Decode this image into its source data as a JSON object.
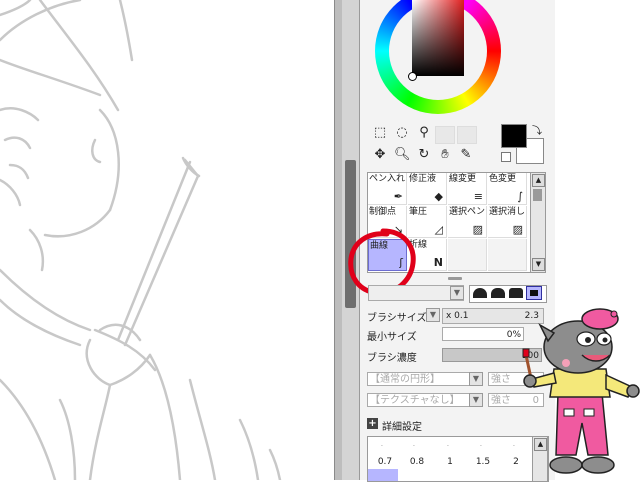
{
  "brush_modes": {
    "row1": [
      "ペン入れ",
      "修正液",
      "線変更",
      "色変更"
    ],
    "row2": [
      "制御点",
      "筆圧",
      "選択ペン",
      "選択消し"
    ],
    "row3": [
      "曲線",
      "折線"
    ]
  },
  "brush_size": {
    "label": "ブラシサイズ",
    "multiplier": "x 0.1",
    "value": "2.3"
  },
  "min_size": {
    "label": "最小サイズ",
    "value": "0%"
  },
  "brush_density": {
    "label": "ブラシ濃度",
    "value": "100"
  },
  "shape_select": {
    "value": "【通常の円形】",
    "strength": "強さ"
  },
  "texture_select": {
    "value": "【テクスチャなし】",
    "strength": "強さ",
    "strength_value": "0"
  },
  "detail_settings": {
    "label": "詳細設定",
    "icon": "plus-icon"
  },
  "size_presets": [
    "0.7",
    "0.8",
    "1",
    "1.5",
    "2"
  ],
  "tools": {
    "row1": [
      "select-rect-icon",
      "lasso-icon",
      "magic-wand-icon"
    ],
    "row2": [
      "move-icon",
      "zoom-icon",
      "rotate-icon",
      "hand-icon",
      "eyedropper-icon"
    ]
  },
  "colors": {
    "primary": "#000000",
    "secondary": "#ffffff",
    "highlight": "#e0001a",
    "selected_cell": "#b6b6ff"
  }
}
